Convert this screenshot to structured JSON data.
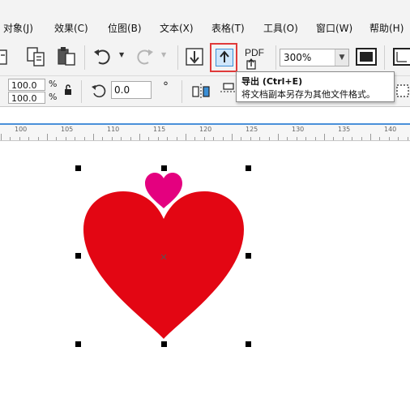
{
  "menubar": {
    "items": [
      {
        "label": "对象(J)"
      },
      {
        "label": "效果(C)"
      },
      {
        "label": "位图(B)"
      },
      {
        "label": "文本(X)"
      },
      {
        "label": "表格(T)"
      },
      {
        "label": "工具(O)"
      },
      {
        "label": "窗口(W)"
      },
      {
        "label": "帮助(H)"
      }
    ]
  },
  "toolbar": {
    "pdf_label": "PDF",
    "zoom_value": "300%",
    "scale_x": "100.0",
    "scale_y": "100.0",
    "percent_symbol": "%",
    "rotation_value": "0.0",
    "degree_symbol": "°"
  },
  "tooltip": {
    "title": "导出 (Ctrl+E)",
    "description": "将文档副本另存为其他文件格式。"
  },
  "ruler": {
    "labels": [
      "100",
      "105",
      "110",
      "115",
      "120",
      "125",
      "130",
      "135",
      "140"
    ]
  },
  "colors": {
    "big_heart": "#e30613",
    "small_heart": "#e4007f",
    "highlight": "#e03a3a"
  }
}
